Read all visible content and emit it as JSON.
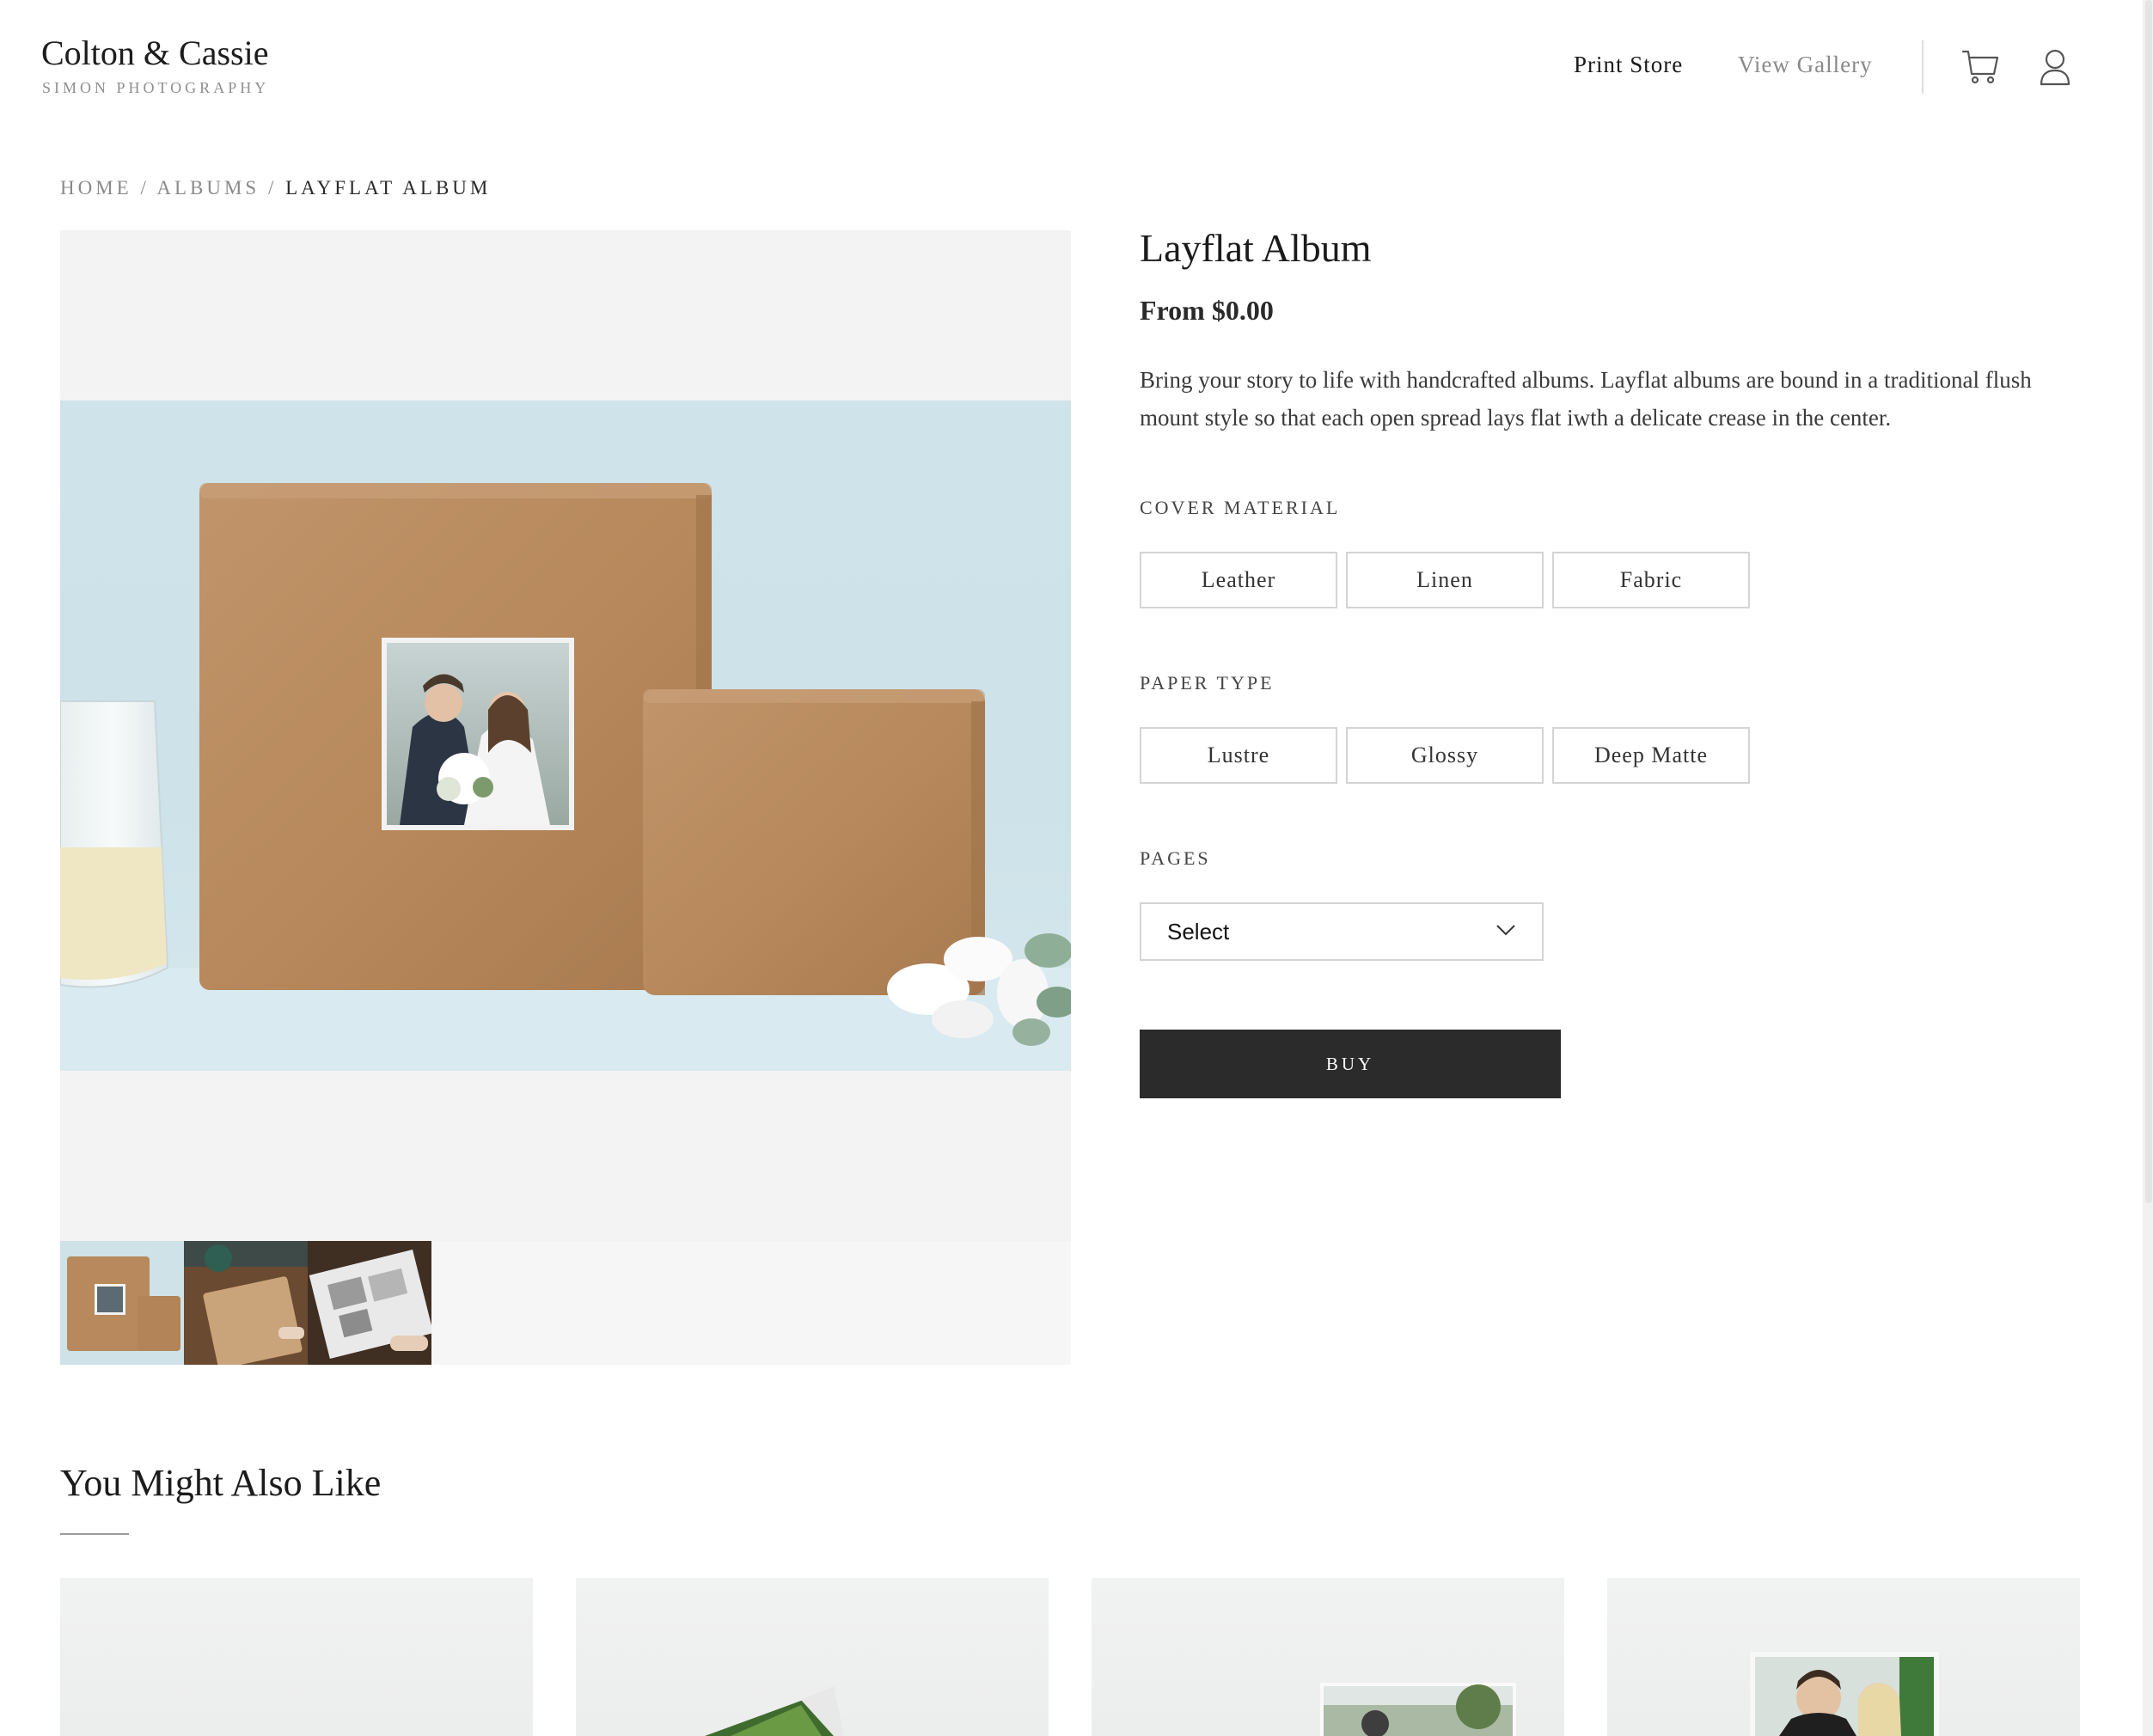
{
  "brand": {
    "title": "Colton & Cassie",
    "subtitle": "SIMON PHOTOGRAPHY"
  },
  "nav": {
    "links": [
      {
        "label": "Print Store"
      },
      {
        "label": "View Gallery"
      }
    ],
    "icons": [
      "cart-icon",
      "user-icon"
    ]
  },
  "breadcrumb": {
    "home": "HOME",
    "albums": "ALBUMS",
    "current": "LAYFLAT ALBUM",
    "separator": "/"
  },
  "product": {
    "title": "Layflat Album",
    "price": "From $0.00",
    "description": "Bring your story to life with handcrafted albums. Layflat albums are bound in a traditional flush mount style so that each open spread lays flat iwth a delicate crease in the center.",
    "cover_material": {
      "label": "COVER MATERIAL",
      "options": [
        "Leather",
        "Linen",
        "Fabric"
      ]
    },
    "paper_type": {
      "label": "PAPER TYPE",
      "options": [
        "Lustre",
        "Glossy",
        "Deep Matte"
      ]
    },
    "pages": {
      "label": "PAGES",
      "selected": "Select"
    },
    "buy_label": "BUY",
    "thumbnail_count": 3
  },
  "recommendations": {
    "title": "You Might Also Like",
    "card_count": 4
  },
  "colors": {
    "button_dark": "#2b2b2b",
    "border": "#d4d4d4",
    "leather": "#b88a5e",
    "backdrop": "#cfe3ea"
  }
}
